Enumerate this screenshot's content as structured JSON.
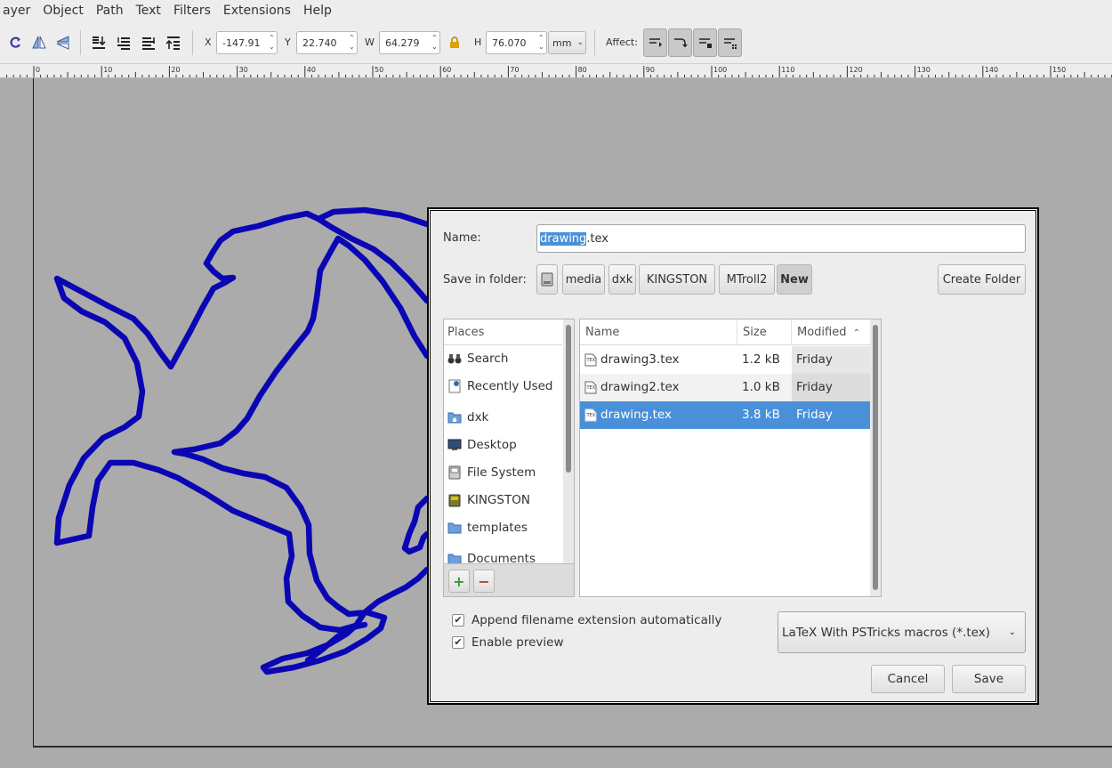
{
  "menubar": {
    "items": [
      "ayer",
      "Object",
      "Path",
      "Text",
      "Filters",
      "Extensions",
      "Help"
    ]
  },
  "toolbar": {
    "x_label": "X",
    "x_value": "-147.91",
    "y_label": "Y",
    "y_value": "22.740",
    "w_label": "W",
    "w_value": "64.279",
    "h_label": "H",
    "h_value": "76.070",
    "unit": "mm",
    "affect_label": "Affect:"
  },
  "ruler": {
    "labels": [
      "0",
      "10",
      "20",
      "30",
      "40",
      "50",
      "60",
      "70",
      "80",
      "90",
      "100",
      "110",
      "120",
      "130",
      "140",
      "150"
    ]
  },
  "dialog": {
    "name_label": "Name:",
    "name_selected": "drawing",
    "name_rest": ".tex",
    "save_in_label": "Save in folder:",
    "path_buttons": [
      "media",
      "dxk",
      "KINGSTON",
      "MTroll2",
      "New"
    ],
    "create_folder": "Create Folder",
    "places_header": "Places",
    "places": [
      {
        "label": "Search",
        "icon": "binoculars-icon"
      },
      {
        "label": "Recently Used",
        "icon": "recent-icon"
      },
      {
        "label": "dxk",
        "icon": "home-folder-icon"
      },
      {
        "label": "Desktop",
        "icon": "desktop-icon"
      },
      {
        "label": "File System",
        "icon": "drive-icon"
      },
      {
        "label": "KINGSTON",
        "icon": "usb-drive-icon"
      },
      {
        "label": "templates",
        "icon": "folder-icon"
      },
      {
        "label": "Documents",
        "icon": "folder-icon"
      }
    ],
    "files_header": {
      "name": "Name",
      "size": "Size",
      "modified": "Modified"
    },
    "files": [
      {
        "name": "drawing3.tex",
        "size": "1.2 kB",
        "modified": "Friday"
      },
      {
        "name": "drawing2.tex",
        "size": "1.0 kB",
        "modified": "Friday"
      },
      {
        "name": "drawing.tex",
        "size": "3.8 kB",
        "modified": "Friday"
      }
    ],
    "append_ext_label": "Append filename extension automatically",
    "append_ext_checked": true,
    "preview_label": "Enable preview",
    "preview_checked": true,
    "filter": "LaTeX With PSTricks macros (*.tex)",
    "cancel": "Cancel",
    "save": "Save"
  },
  "colors": {
    "shape_stroke": "#0a06b4",
    "selection": "#4a90d9",
    "canvas": "#ababab"
  }
}
